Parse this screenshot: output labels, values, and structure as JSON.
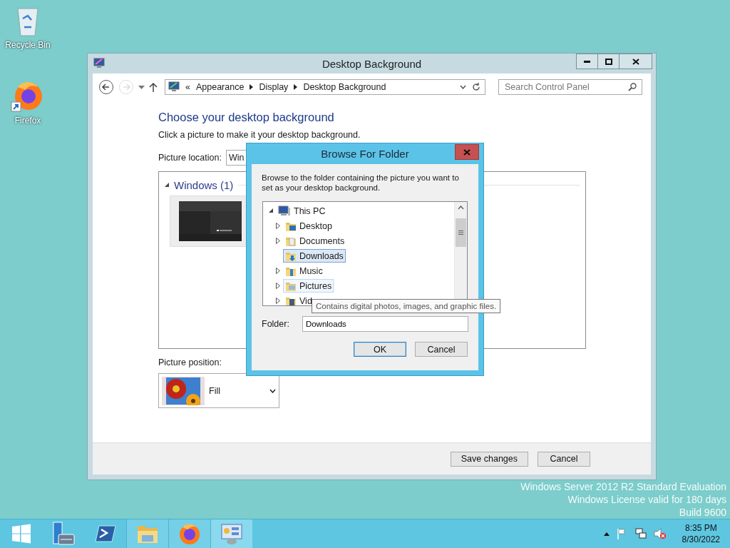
{
  "desktop_icons": [
    {
      "kind": "recycle",
      "label": "Recycle Bin"
    },
    {
      "kind": "firefox",
      "label": "Firefox"
    }
  ],
  "window": {
    "title": "Desktop Background",
    "address": {
      "overflow": "«",
      "crumbs": [
        "Appearance",
        "Display",
        "Desktop Background"
      ]
    },
    "search": {
      "placeholder": "Search Control Panel"
    },
    "heading": "Choose your desktop background",
    "subtitle": "Click a picture to make it your desktop background.",
    "location": {
      "label": "Picture location:",
      "value": "Win"
    },
    "group": {
      "label": "Windows (1)",
      "expanded": true
    },
    "position": {
      "label": "Picture position:",
      "value": "Fill"
    },
    "buttons": [
      "Save changes",
      "Cancel"
    ]
  },
  "dialog": {
    "title": "Browse For Folder",
    "instructions": "Browse to the folder containing the picture you want to set as your desktop background.",
    "tree": [
      {
        "label": "This PC",
        "kind": "pc",
        "expanded": true,
        "selected": false,
        "hot": false,
        "children": [
          {
            "label": "Desktop",
            "kind": "desktop",
            "expanded": false,
            "selected": false,
            "hot": false
          },
          {
            "label": "Documents",
            "kind": "documents",
            "expanded": false,
            "selected": false,
            "hot": false
          },
          {
            "label": "Downloads",
            "kind": "downloads",
            "selected": true,
            "hot": false
          },
          {
            "label": "Music",
            "kind": "music",
            "expanded": false,
            "selected": false,
            "hot": false
          },
          {
            "label": "Pictures",
            "kind": "pictures",
            "expanded": false,
            "selected": false,
            "hot": true
          },
          {
            "label": "Vid",
            "kind": "videos",
            "expanded": false,
            "selected": false,
            "hot": false
          }
        ]
      }
    ],
    "folder": {
      "label": "Folder:",
      "value": "Downloads"
    },
    "buttons": [
      {
        "label": "OK",
        "default": true
      },
      {
        "label": "Cancel",
        "default": false
      }
    ]
  },
  "tooltip": "Contains digital photos, images, and graphic files.",
  "watermark": [
    "Windows Server 2012 R2 Standard Evaluation",
    "Windows License valid for 180 days",
    "Build 9600"
  ],
  "taskbar": {
    "items": [
      {
        "kind": "start",
        "running": false,
        "selected": false
      },
      {
        "kind": "server",
        "running": false,
        "selected": false
      },
      {
        "kind": "powershell",
        "running": false,
        "selected": false
      },
      {
        "kind": "explorer",
        "running": true,
        "selected": false
      },
      {
        "kind": "firefox",
        "running": true,
        "selected": false
      },
      {
        "kind": "controlpanel",
        "running": true,
        "selected": true
      }
    ],
    "time": "8:35 PM",
    "date": "8/30/2022"
  }
}
